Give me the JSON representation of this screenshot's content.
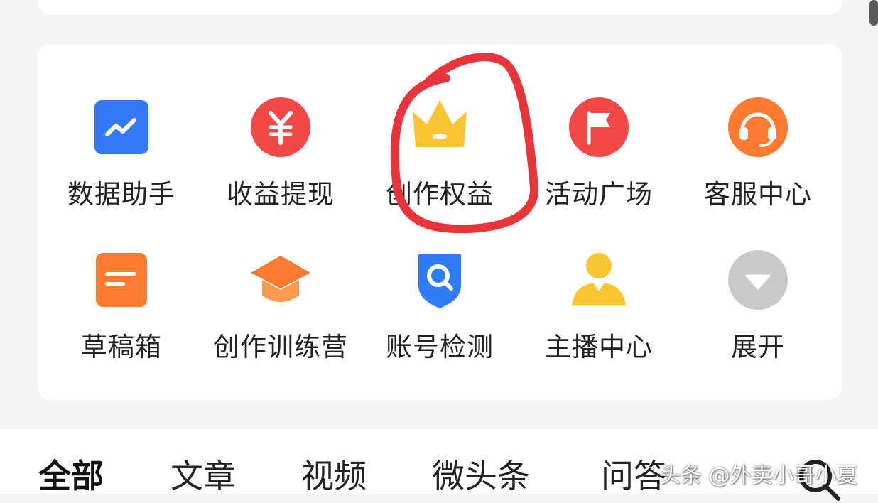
{
  "tools": {
    "row1": [
      {
        "label": "数据助手",
        "icon": "trend-chart-icon",
        "color": "#3478f6"
      },
      {
        "label": "收益提现",
        "icon": "yuan-coin-icon",
        "color": "#f34848"
      },
      {
        "label": "创作权益",
        "icon": "crown-icon",
        "color": "#fbc531"
      },
      {
        "label": "活动广场",
        "icon": "flag-icon",
        "color": "#f34848"
      },
      {
        "label": "客服中心",
        "icon": "headset-icon",
        "color": "#ff7a2e"
      }
    ],
    "row2": [
      {
        "label": "草稿箱",
        "icon": "draft-note-icon",
        "color": "#ff7a2e"
      },
      {
        "label": "创作训练营",
        "icon": "graduation-cap-icon",
        "color": "#ff7a2e"
      },
      {
        "label": "账号检测",
        "icon": "shield-search-icon",
        "color": "#2f7cf6"
      },
      {
        "label": "主播中心",
        "icon": "user-avatar-icon",
        "color": "#fbc531"
      },
      {
        "label": "展开",
        "icon": "expand-down-icon",
        "color": "#c9c9c9"
      }
    ]
  },
  "tabs": [
    {
      "label": "全部",
      "active": true
    },
    {
      "label": "文章",
      "active": false
    },
    {
      "label": "视频",
      "active": false
    },
    {
      "label": "微头条",
      "active": false
    },
    {
      "label": "问答",
      "active": false
    }
  ],
  "watermark": "头条 @外卖小哥小夏",
  "annotation_color": "#e8343a"
}
